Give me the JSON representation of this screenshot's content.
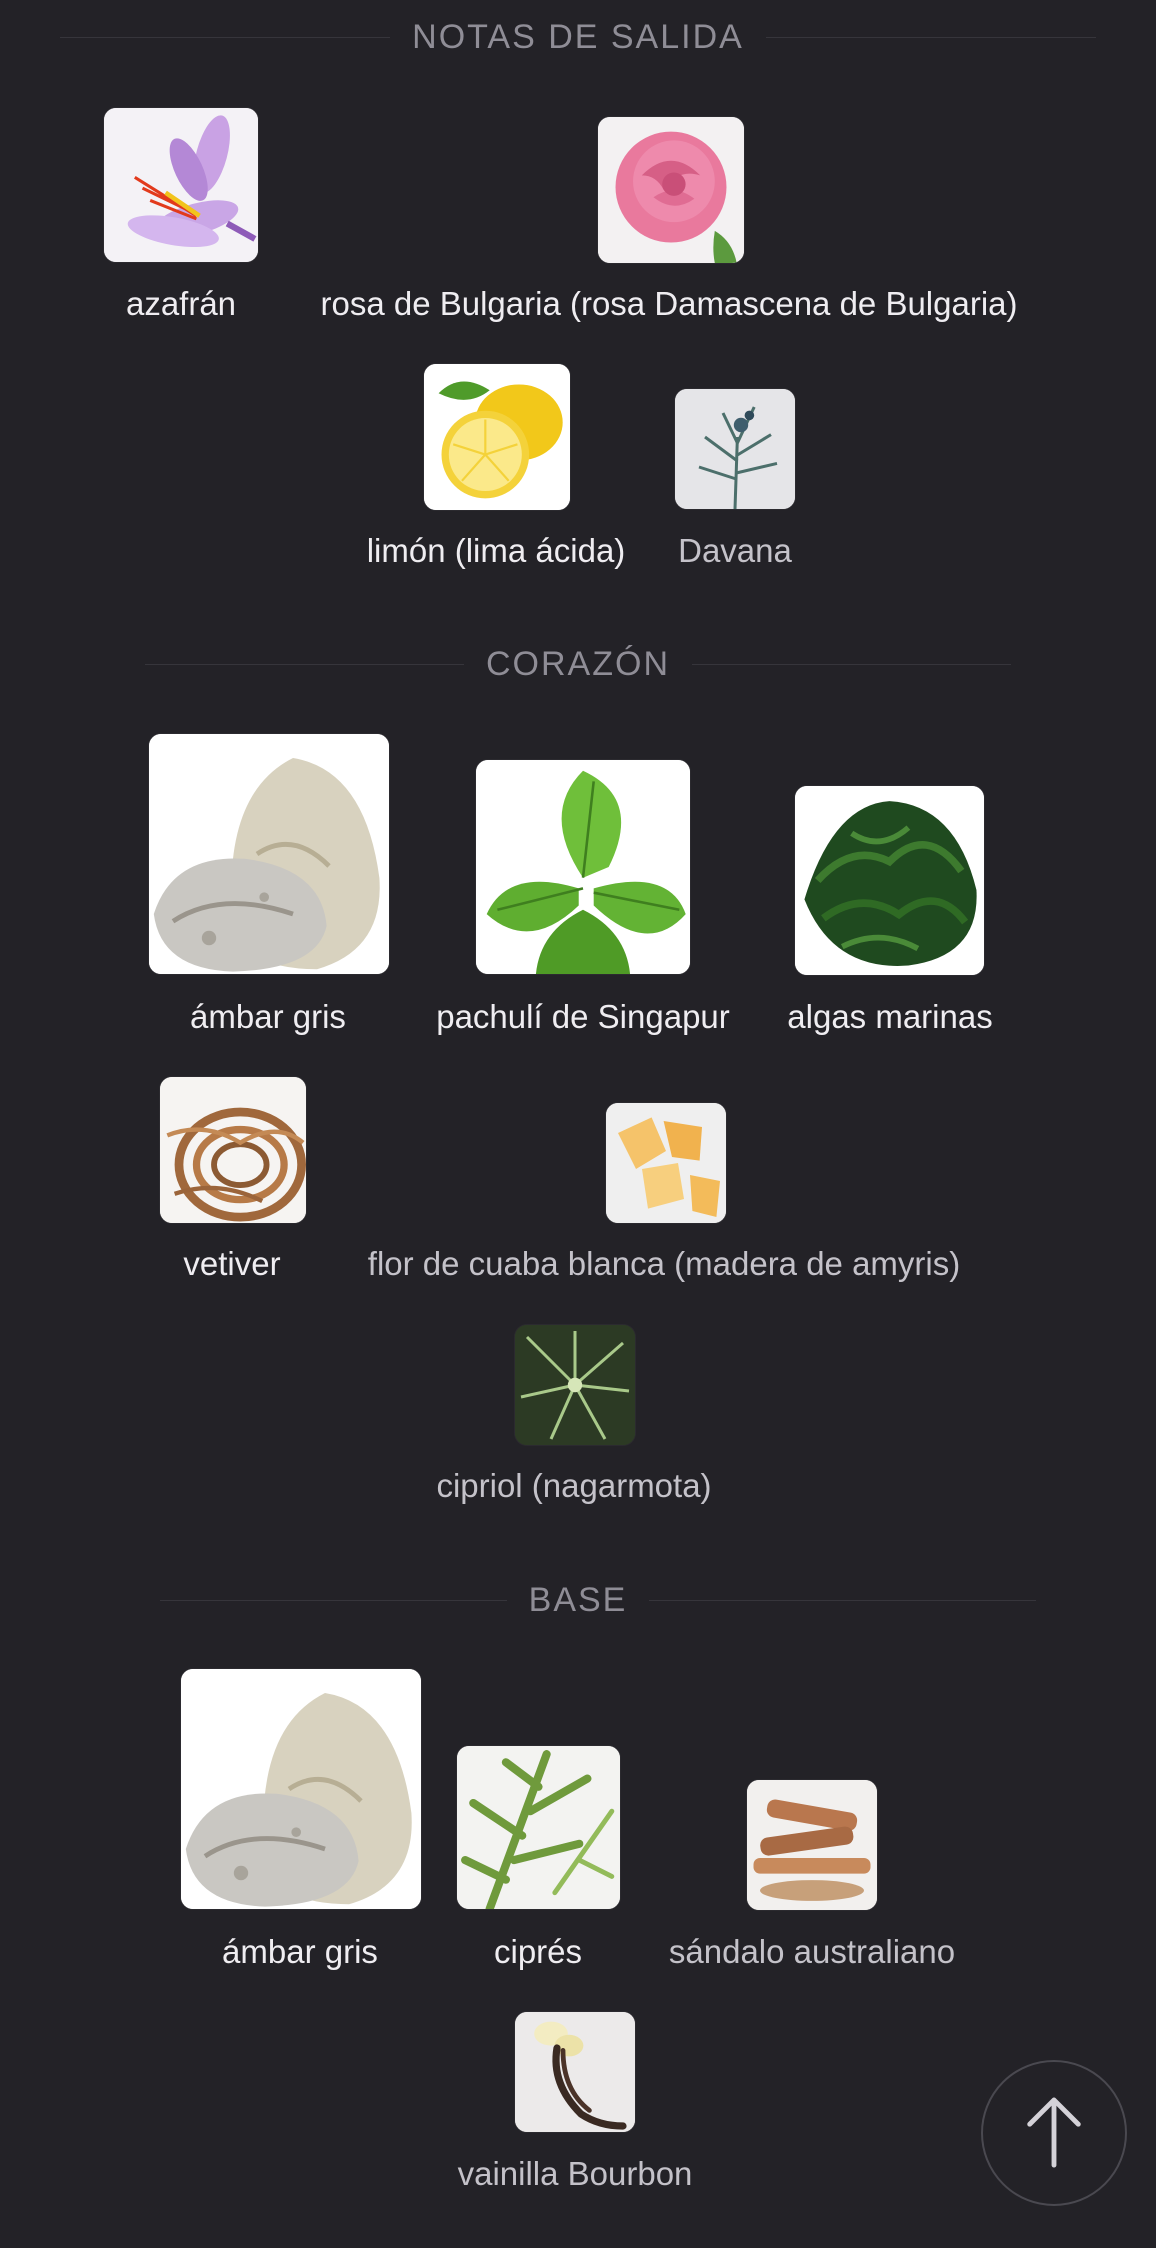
{
  "sections": {
    "top": {
      "title": "NOTAS DE SALIDA"
    },
    "heart": {
      "title": "CORAZÓN"
    },
    "base": {
      "title": "BASE"
    }
  },
  "notes": {
    "top": [
      {
        "label": "azafrán",
        "icon": "saffron-image"
      },
      {
        "label": "rosa de Bulgaria (rosa Damascena de Bulgaria)",
        "icon": "rose-image"
      },
      {
        "label": "limón (lima ácida)",
        "icon": "lemon-image"
      },
      {
        "label": "Davana",
        "icon": "davana-image"
      }
    ],
    "heart": [
      {
        "label": "ámbar gris",
        "icon": "ambergris-image"
      },
      {
        "label": "pachulí de Singapur",
        "icon": "patchouli-image"
      },
      {
        "label": "algas marinas",
        "icon": "seaweed-image"
      },
      {
        "label": "vetiver",
        "icon": "vetiver-image"
      },
      {
        "label": "flor de cuaba blanca (madera de amyris)",
        "icon": "amyris-image"
      },
      {
        "label": "cipriol (nagarmota)",
        "icon": "cypriol-image"
      }
    ],
    "base": [
      {
        "label": "ámbar gris",
        "icon": "ambergris-image"
      },
      {
        "label": "ciprés",
        "icon": "cypress-image"
      },
      {
        "label": "sándalo australiano",
        "icon": "sandalwood-image"
      },
      {
        "label": "vainilla Bourbon",
        "icon": "vanilla-image"
      }
    ]
  },
  "scroll_top": {
    "icon": "arrow-up-icon"
  },
  "colors": {
    "background": "#232227",
    "heading": "#8f8d96",
    "label": "#efedf1"
  }
}
